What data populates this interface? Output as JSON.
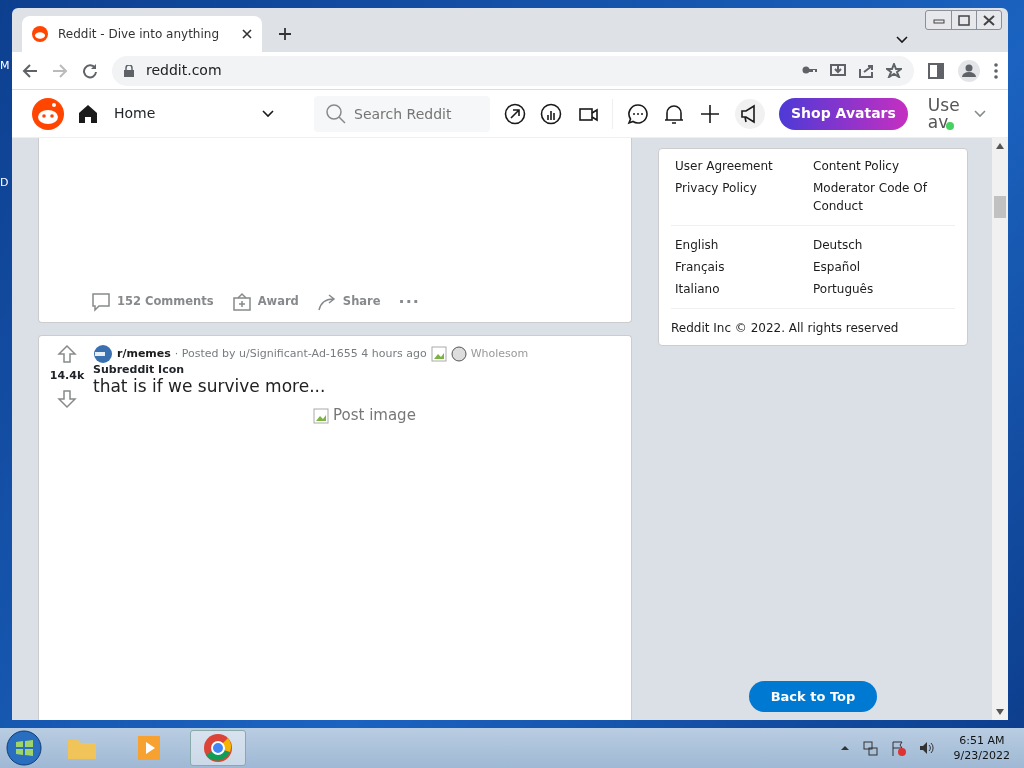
{
  "desktop_icons": [
    "M",
    "D"
  ],
  "browser": {
    "tab": {
      "title": "Reddit - Dive into anything",
      "selected": true
    },
    "address": "reddit.com"
  },
  "header": {
    "feed": "Home",
    "search": {
      "placeholder": "Search Reddit"
    },
    "shop_button": "Shop Avatars",
    "user": [
      "Use",
      "av"
    ],
    "online": true
  },
  "posts": [
    {
      "actions": [
        {
          "kind": "comments",
          "label": "152 Comments"
        },
        {
          "kind": "award",
          "label": "Award"
        },
        {
          "kind": "share",
          "label": "Share"
        },
        {
          "kind": "more",
          "label": "···"
        }
      ]
    },
    {
      "score": "14.4k",
      "subreddit": "r/memes",
      "meta": "· Posted by u/Significant-Ad-1655 4 hours ago",
      "awards": [
        "Wholesom"
      ],
      "icon_alt": [
        "Subreddit",
        "Icon"
      ],
      "title": "that is if we survive more...",
      "image_alt": "Post image"
    }
  ],
  "sidebar": {
    "links": [
      [
        "User Agreement",
        "Content Policy"
      ],
      [
        "Privacy Policy",
        "Moderator Code Of Conduct"
      ]
    ],
    "languages": [
      [
        "English",
        "Deutsch"
      ],
      [
        "Français",
        "Español"
      ],
      [
        "Italiano",
        "Português"
      ]
    ],
    "copyright": "Reddit Inc © 2022. All rights reserved"
  },
  "back_to_top": "Back to Top",
  "taskbar": {
    "time": "6:51 AM",
    "date": "9/23/2022"
  }
}
